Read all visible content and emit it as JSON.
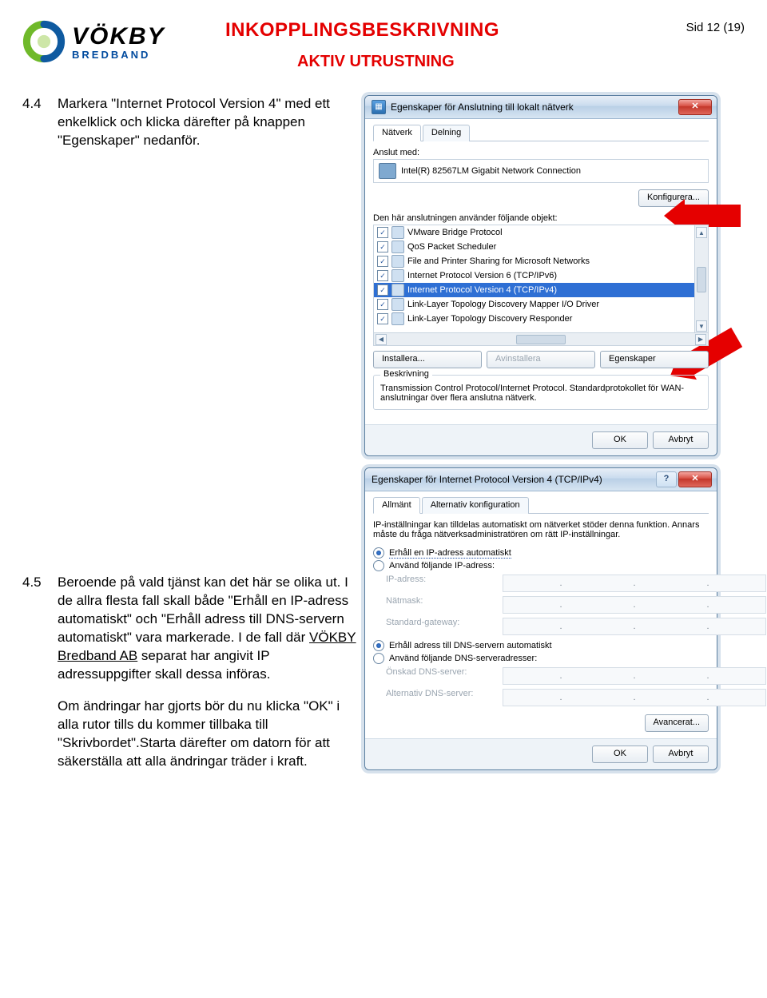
{
  "logo": {
    "word": "VÖKBY",
    "sub": "BREDBAND"
  },
  "header": {
    "title": "INKOPPLINGSBESKRIVNING",
    "subtitle": "AKTIV UTRUSTNING",
    "page": "Sid 12 (19)"
  },
  "steps": {
    "s44_num": "4.4",
    "s44_text": "Markera \"Internet Protocol Version 4\" med ett enkelklick och klicka därefter på knappen \"Egenskaper\" nedanför.",
    "s45_num": "4.5",
    "s45_p1_a": "Beroende på vald tjänst kan det här se olika ut. I de allra flesta fall skall både \"Erhåll en IP-adress automatiskt\" och \"Erhåll adress till DNS-servern automatiskt\" vara markerade. I de fall där ",
    "s45_link": "VÖKBY Bredband AB",
    "s45_p1_b": " separat har angivit IP adressuppgifter skall dessa införas.",
    "s45_p2": "Om ändringar har gjorts bör du nu klicka \"OK\" i alla rutor tills du kommer tillbaka till \"Skrivbordet\".Starta därefter om datorn för att säkerställa att alla ändringar träder i kraft."
  },
  "dlg1": {
    "title": "Egenskaper för Anslutning till lokalt nätverk",
    "tab1": "Nätverk",
    "tab2": "Delning",
    "connectWith": "Anslut med:",
    "adapter": "Intel(R) 82567LM Gigabit Network Connection",
    "configure": "Konfigurera...",
    "listLabel": "Den här anslutningen använder följande objekt:",
    "items": [
      "VMware Bridge Protocol",
      "QoS Packet Scheduler",
      "File and Printer Sharing for Microsoft Networks",
      "Internet Protocol Version 6 (TCP/IPv6)",
      "Internet Protocol Version 4 (TCP/IPv4)",
      "Link-Layer Topology Discovery Mapper I/O Driver",
      "Link-Layer Topology Discovery Responder"
    ],
    "install": "Installera...",
    "uninstall": "Avinstallera",
    "properties": "Egenskaper",
    "descTitle": "Beskrivning",
    "descText": "Transmission Control Protocol/Internet Protocol. Standardprotokollet för WAN-anslutningar över flera anslutna nätverk.",
    "ok": "OK",
    "cancel": "Avbryt"
  },
  "dlg2": {
    "title": "Egenskaper för Internet Protocol Version 4 (TCP/IPv4)",
    "tab1": "Allmänt",
    "tab2": "Alternativ konfiguration",
    "intro": "IP-inställningar kan tilldelas automatiskt om nätverket stöder denna funktion. Annars måste du fråga nätverksadministratören om rätt IP-inställningar.",
    "r1": "Erhåll en IP-adress automatiskt",
    "r2": "Använd följande IP-adress:",
    "lab_ip": "IP-adress:",
    "lab_mask": "Nätmask:",
    "lab_gw": "Standard-gateway:",
    "r3": "Erhåll adress till DNS-servern automatiskt",
    "r4": "Använd följande DNS-serveradresser:",
    "lab_dns1": "Önskad DNS-server:",
    "lab_dns2": "Alternativ DNS-server:",
    "advanced": "Avancerat...",
    "ok": "OK",
    "cancel": "Avbryt"
  }
}
